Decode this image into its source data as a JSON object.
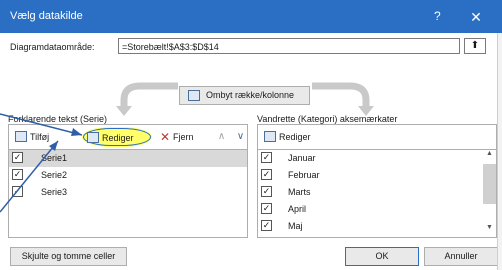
{
  "window": {
    "title": "Vælg datakilde",
    "help_glyph": "?",
    "close_glyph": "✕"
  },
  "range": {
    "label": "Diagramdataområde:",
    "value": "=Storebælt!$A$3:$D$14",
    "collapse_glyph": "⬆"
  },
  "switch": {
    "label": "Ombyt række/kolonne"
  },
  "legend": {
    "label": "Forklarende tekst (Serie)",
    "add_label": "Tilføj",
    "edit_label": "Rediger",
    "remove_label": "Fjern",
    "up_glyph": "∧",
    "down_glyph": "∨",
    "series": [
      {
        "name": "Serie1",
        "checked": true,
        "selected": true
      },
      {
        "name": "Serie2",
        "checked": true,
        "selected": false
      },
      {
        "name": "Serie3",
        "checked": true,
        "selected": false
      }
    ]
  },
  "category": {
    "label": "Vandrette (Kategori) aksemærkater",
    "edit_label": "Rediger",
    "items": [
      {
        "name": "Januar",
        "checked": true
      },
      {
        "name": "Februar",
        "checked": true
      },
      {
        "name": "Marts",
        "checked": true
      },
      {
        "name": "April",
        "checked": true
      },
      {
        "name": "Maj",
        "checked": true
      }
    ]
  },
  "footer": {
    "hidden_cells_label": "Skjulte og tomme celler",
    "ok_label": "OK",
    "cancel_label": "Annuller"
  },
  "colors": {
    "titlebar": "#2b6fc4",
    "highlight": "#ffff6a",
    "annotation_arrow": "#2f5ea8"
  }
}
